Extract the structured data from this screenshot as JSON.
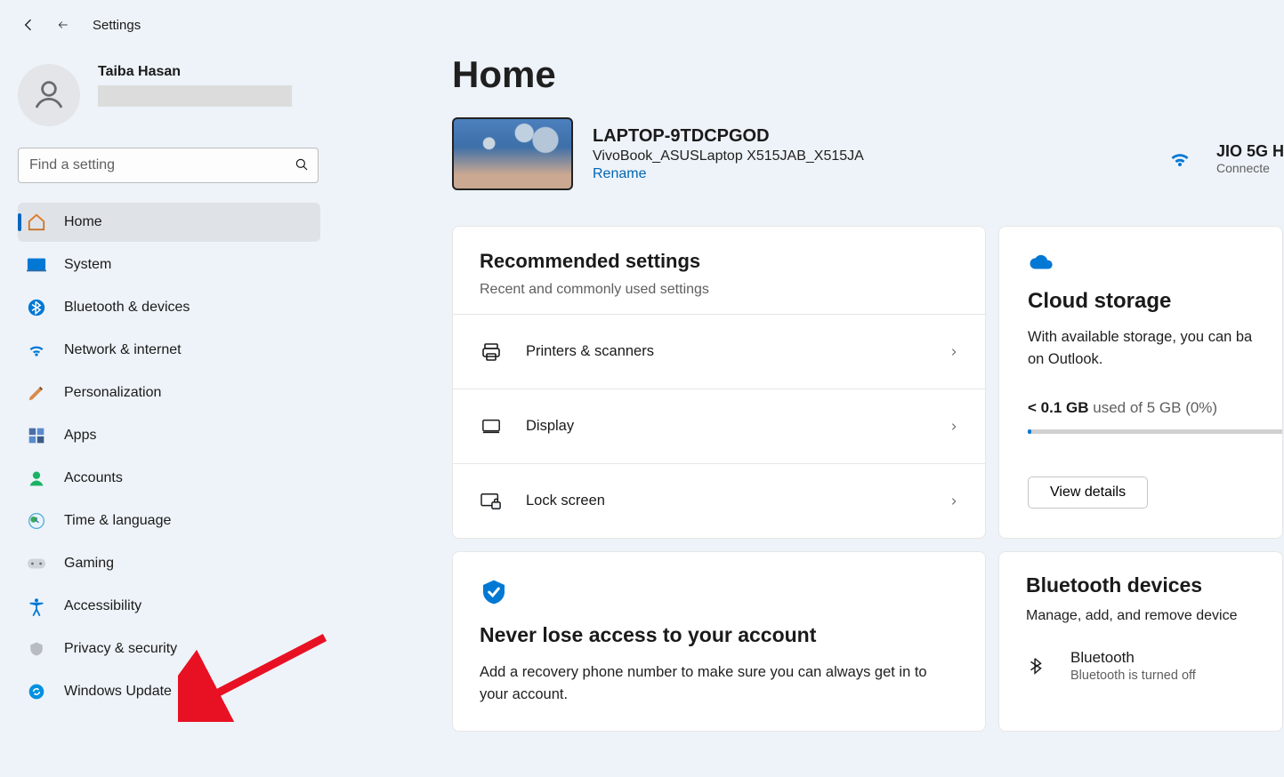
{
  "header": {
    "app_title": "Settings"
  },
  "user": {
    "name": "Taiba Hasan"
  },
  "search": {
    "placeholder": "Find a setting"
  },
  "sidebar": {
    "items": [
      {
        "label": "Home"
      },
      {
        "label": "System"
      },
      {
        "label": "Bluetooth & devices"
      },
      {
        "label": "Network & internet"
      },
      {
        "label": "Personalization"
      },
      {
        "label": "Apps"
      },
      {
        "label": "Accounts"
      },
      {
        "label": "Time & language"
      },
      {
        "label": "Gaming"
      },
      {
        "label": "Accessibility"
      },
      {
        "label": "Privacy & security"
      },
      {
        "label": "Windows Update"
      }
    ]
  },
  "main": {
    "title": "Home",
    "device": {
      "name": "LAPTOP-9TDCPGOD",
      "model": "VivoBook_ASUSLaptop X515JAB_X515JA",
      "rename": "Rename"
    },
    "wifi": {
      "name": "JIO 5G H",
      "status": "Connecte"
    },
    "recommended": {
      "title": "Recommended settings",
      "subtitle": "Recent and commonly used settings",
      "items": [
        {
          "label": "Printers & scanners"
        },
        {
          "label": "Display"
        },
        {
          "label": "Lock screen"
        }
      ]
    },
    "cloud": {
      "title": "Cloud storage",
      "desc": "With available storage, you can ba on Outlook.",
      "used_bold": "< 0.1 GB",
      "used_rest": " used of 5 GB (0%)",
      "view_details": "View details"
    },
    "account_card": {
      "title": "Never lose access to your account",
      "desc": "Add a recovery phone number to make sure you can always get in to your account."
    },
    "bt_card": {
      "title": "Bluetooth devices",
      "sub": "Manage, add, and remove device",
      "row_name": "Bluetooth",
      "row_status": "Bluetooth is turned off"
    }
  }
}
